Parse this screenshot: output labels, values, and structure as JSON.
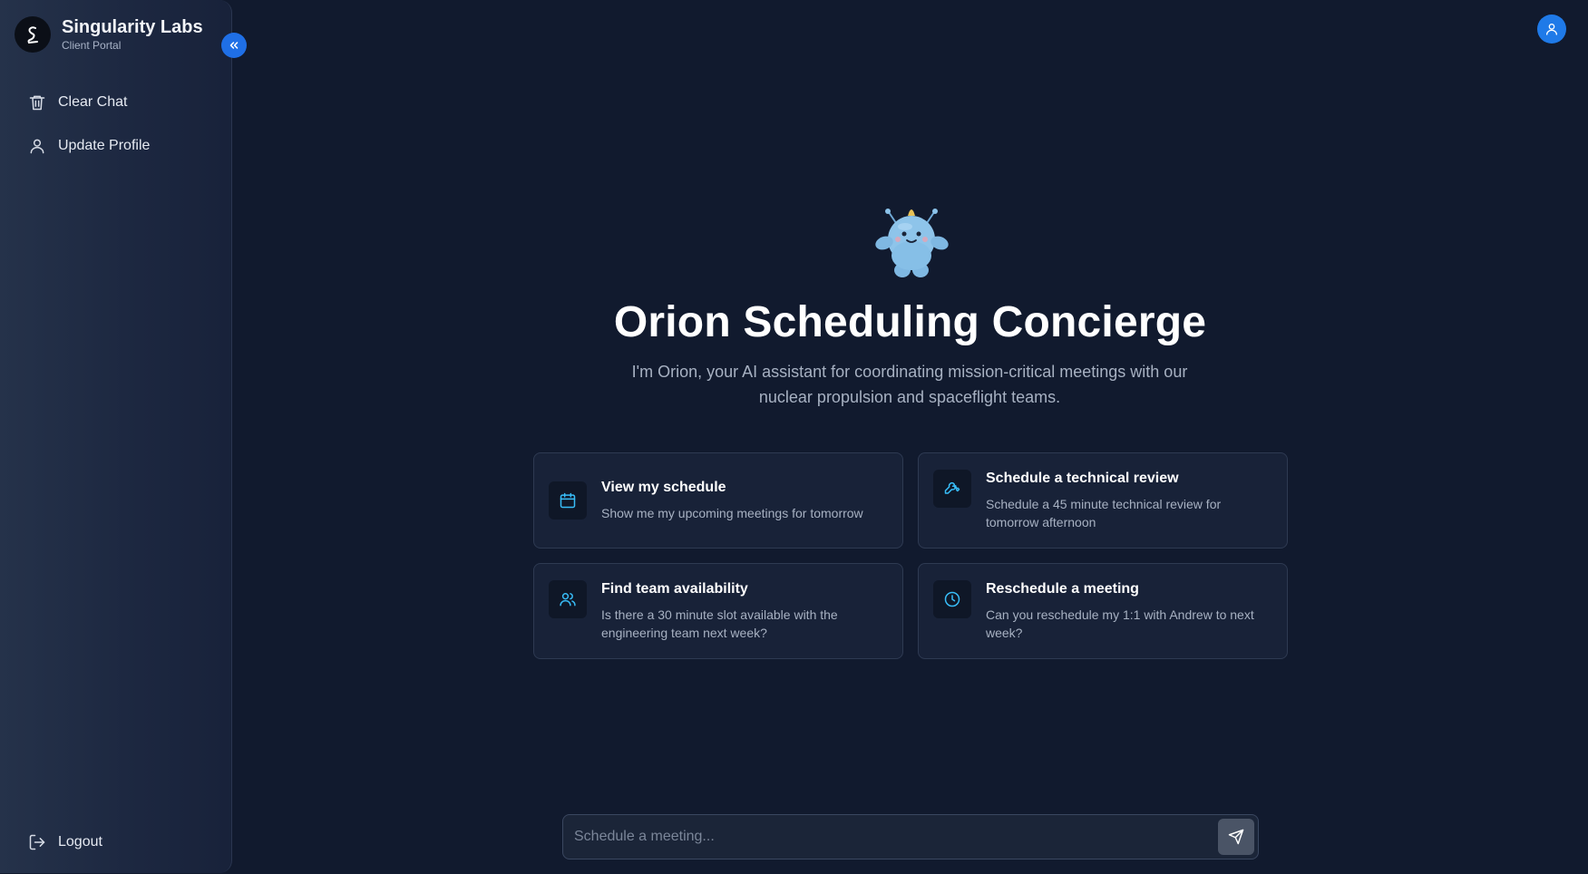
{
  "brand": {
    "name": "Singularity Labs",
    "subtitle": "Client Portal",
    "logo_icon": "signature-s-icon"
  },
  "sidebar": {
    "collapse_icon": "chevrons-left-icon",
    "items": [
      {
        "label": "Clear Chat",
        "icon": "trash-icon"
      },
      {
        "label": "Update Profile",
        "icon": "user-icon"
      }
    ],
    "logout": {
      "label": "Logout",
      "icon": "logout-icon"
    }
  },
  "header": {
    "avatar_icon": "user-icon"
  },
  "hero": {
    "title": "Orion Scheduling Concierge",
    "subtitle": "I'm Orion, your AI assistant for coordinating mission-critical meetings with our nuclear propulsion and spaceflight teams.",
    "mascot": "robot-mascot"
  },
  "suggestions": [
    {
      "title": "View my schedule",
      "description": "Show me my upcoming meetings for tomorrow",
      "icon": "calendar-icon"
    },
    {
      "title": "Schedule a technical review",
      "description": "Schedule a 45 minute technical review for tomorrow afternoon",
      "icon": "wrench-icon"
    },
    {
      "title": "Find team availability",
      "description": "Is there a 30 minute slot available with the engineering team next week?",
      "icon": "users-icon"
    },
    {
      "title": "Reschedule a meeting",
      "description": "Can you reschedule my 1:1 with Andrew to next week?",
      "icon": "clock-icon"
    }
  ],
  "composer": {
    "placeholder": "Schedule a meeting...",
    "value": "",
    "send_icon": "send-icon"
  },
  "colors": {
    "background": "#111a2e",
    "accent": "#1f6fe6",
    "icon_cyan": "#38bdf8",
    "card_bg": "#182238",
    "card_border": "#2e3a52"
  }
}
